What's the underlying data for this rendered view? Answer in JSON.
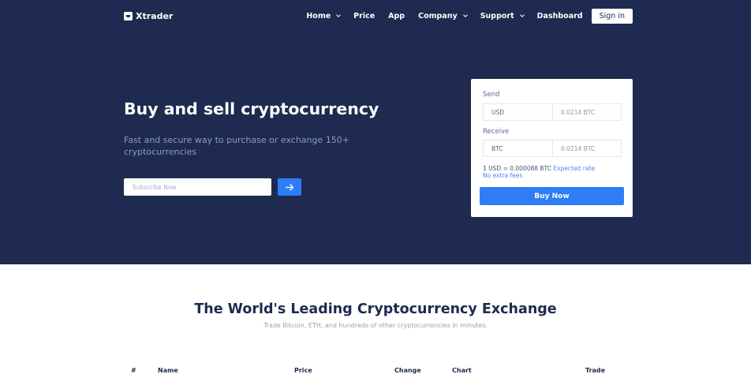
{
  "brand": {
    "name": "Xtrader",
    "icon": "logo-icon"
  },
  "nav": {
    "items": [
      {
        "label": "Home",
        "has_dropdown": true
      },
      {
        "label": "Price",
        "has_dropdown": false
      },
      {
        "label": "App",
        "has_dropdown": false
      },
      {
        "label": "Company",
        "has_dropdown": true
      },
      {
        "label": "Support",
        "has_dropdown": true
      },
      {
        "label": "Dashboard",
        "has_dropdown": false
      }
    ],
    "signin_label": "Sign in"
  },
  "hero": {
    "title": "Buy and sell cryptocurrency",
    "subtitle": "Fast and secure way to purchase or exchange 150+ cryptocurrencies",
    "subscribe_placeholder": "Subscribe Now",
    "submit_icon": "arrow-right-icon"
  },
  "exchange": {
    "send_label": "Send",
    "send_currency": "USD",
    "send_amount": "0.0214 BTC",
    "receive_label": "Receive",
    "receive_currency": "BTC",
    "receive_amount": "0.0214 BTC",
    "rate_text": "1 USD = 0.000088 BTC",
    "rate_link": "Expected rate",
    "fees_text": "No extra fees",
    "buy_label": "Buy Now"
  },
  "market": {
    "title": "The World's Leading Cryptocurrency Exchange",
    "subtitle": "Trade Bitcoin, ETH, and hundreds of other cryptocurrencies in minutes.",
    "columns": [
      "#",
      "Name",
      "Price",
      "Change",
      "Chart",
      "Trade"
    ]
  },
  "colors": {
    "hero_bg": "#1e2a4f",
    "accent": "#2f7df6",
    "link": "#4a86f0"
  }
}
